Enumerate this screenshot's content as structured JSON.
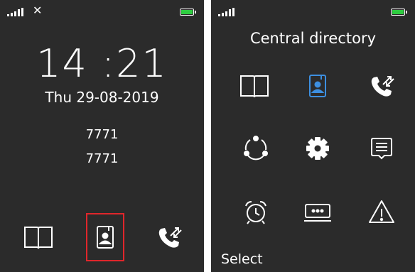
{
  "colors": {
    "screen_bg": "#2b2b2b",
    "text": "#ffffff",
    "battery": "#2ecc40",
    "accent_blue": "#3d8fe0",
    "selection_red": "#e0262b"
  },
  "idle": {
    "status": {
      "network_icon": "x-icon",
      "no_service": "✕"
    },
    "time": "14 :21",
    "date": "Thu 29-08-2019",
    "lines": [
      "7771",
      "7771"
    ],
    "softkeys": [
      {
        "icon": "phonebook-icon"
      },
      {
        "icon": "central-directory-icon",
        "selected": true
      },
      {
        "icon": "call-log-icon"
      }
    ]
  },
  "menu": {
    "title": "Central directory",
    "items": [
      {
        "icon": "phonebook-icon"
      },
      {
        "icon": "central-directory-icon",
        "selected": true
      },
      {
        "icon": "call-log-icon"
      },
      {
        "icon": "connections-icon"
      },
      {
        "icon": "settings-gear-icon"
      },
      {
        "icon": "messages-icon"
      },
      {
        "icon": "alarm-clock-icon"
      },
      {
        "icon": "keyboard-icon"
      },
      {
        "icon": "warning-icon"
      }
    ],
    "softkey_left": "Select"
  }
}
